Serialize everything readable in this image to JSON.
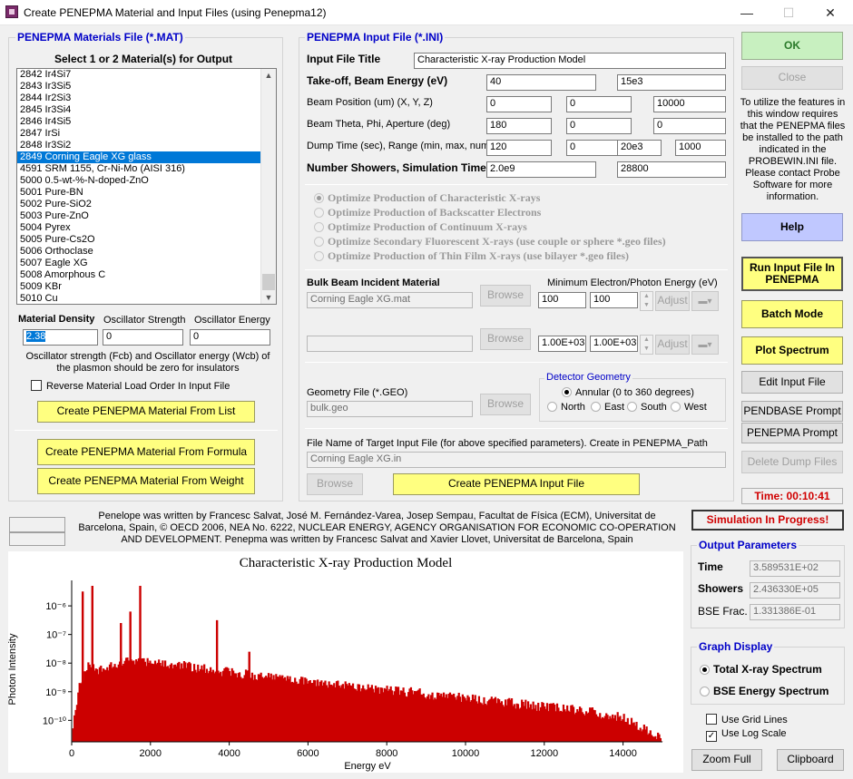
{
  "window": {
    "title": "Create PENEPMA Material and Input Files (using Penepma12)",
    "min": "—",
    "max": "☐",
    "close": "✕"
  },
  "mat": {
    "group_label": "PENEPMA Materials File (*.MAT)",
    "select_heading": "Select 1 or 2 Material(s) for Output",
    "list": [
      "2842 Ir4Si7",
      "2843 Ir3Si5",
      "2844 Ir2Si3",
      "2845 Ir3Si4",
      "2846 Ir4Si5",
      "2847 IrSi",
      "2848 Ir3Si2",
      "2849 Corning Eagle XG glass",
      "4591 SRM 1155, Cr-Ni-Mo (AISI 316)",
      "5000 0.5-wt-%-N-doped-ZnO",
      "5001 Pure-BN",
      "5002 Pure-SiO2",
      "5003 Pure-ZnO",
      "5004 Pyrex",
      "5005 Pure-Cs2O",
      "5006 Orthoclase",
      "5007 Eagle XG",
      "5008 Amorphous C",
      "5009 KBr",
      "5010 Cu"
    ],
    "selected_index": 7,
    "density_label": "Material Density",
    "osc_strength_label": "Oscillator Strength",
    "osc_energy_label": "Oscillator Energy",
    "density": "2.38",
    "osc_strength": "0",
    "osc_energy": "0",
    "note": "Oscillator strength (Fcb) and Oscillator energy (Wcb) of the plasmon should be zero for insulators",
    "reverse_label": "Reverse Material Load Order In Input File",
    "from_list": "Create PENEPMA Material From List",
    "from_formula": "Create PENEPMA Material From Formula",
    "from_weight": "Create PENEPMA Material From Weight"
  },
  "ini": {
    "group_label": "PENEPMA Input File (*.INI)",
    "title_label": "Input File Title",
    "title": "Characteristic X-ray Production Model",
    "takeoff_label": "Take-off, Beam Energy (eV)",
    "takeoff": "40",
    "energy": "15e3",
    "pos_label": "Beam Position (um) (X, Y, Z)",
    "pos": [
      "0",
      "0",
      "10000"
    ],
    "theta_label": "Beam Theta, Phi, Aperture (deg)",
    "theta": [
      "180",
      "0",
      "0"
    ],
    "dump_label": "Dump Time (sec), Range (min, max, num)",
    "dump": [
      "120",
      "0",
      "20e3",
      "1000"
    ],
    "showers_label": "Number Showers, Simulation Time",
    "showers": "2.0e9",
    "simtime": "28800",
    "opts": [
      "Optimize Production of Characteristic X-rays",
      "Optimize Production of Backscatter Electrons",
      "Optimize Production of Continuum X-rays",
      "Optimize Secondary Fluorescent X-rays (use couple or sphere *.geo files)",
      "Optimize Production of Thin Film X-rays (use bilayer *.geo files)"
    ],
    "bulk_label": "Bulk Beam Incident Material",
    "min_energy_label": "Minimum Electron/Photon Energy (eV)",
    "bulk_mat": "Corning Eagle XG.mat",
    "browse": "Browse",
    "e1": "100",
    "e2": "100",
    "adjust": "Adjust",
    "mat2": "",
    "e3": "1.00E+03",
    "e4": "1.00E+03",
    "geo_label": "Geometry File (*.GEO)",
    "geo": "bulk.geo",
    "det_label": "Detector Geometry",
    "annular": "Annular (0 to 360 degrees)",
    "north": "North",
    "east": "East",
    "south": "South",
    "west": "West",
    "target_label": "File Name of Target Input File (for above specified parameters). Create in PENEPMA_Path",
    "target": "Corning Eagle XG.in",
    "create_ini": "Create PENEPMA Input File"
  },
  "right": {
    "ok": "OK",
    "close": "Close",
    "info": "To utilize the features in this window requires that the PENEPMA files be installed to the path indicated in the PROBEWIN.INI file. Please contact Probe Software for more information.",
    "help": "Help",
    "run": "Run Input File In PENEPMA",
    "batch": "Batch Mode",
    "plot": "Plot Spectrum",
    "edit": "Edit Input File",
    "pendbase": "PENDBASE Prompt",
    "penepma_prompt": "PENEPMA Prompt",
    "delete_dump": "Delete Dump Files",
    "time": "Time: 00:10:41"
  },
  "credits": "Penelope was written by Francesc Salvat, José M. Fernández-Varea, Josep Sempau, Facultat de Física (ECM), Universitat de Barcelona, Spain, © OECD 2006, NEA No. 6222, NUCLEAR ENERGY, AGENCY ORGANISATION FOR ECONOMIC CO-OPERATION AND DEVELOPMENT. Penepma was written by Francesc Salvat and Xavier Llovet, Universitat de Barcelona, Spain",
  "status": "Simulation In Progress!",
  "output": {
    "label": "Output Parameters",
    "time_label": "Time",
    "time": "3.589531E+02",
    "showers_label": "Showers",
    "showers": "2.436330E+05",
    "bse_label": "BSE Frac.",
    "bse": "1.331386E-01"
  },
  "graph": {
    "label": "Graph Display",
    "total": "Total X-ray Spectrum",
    "bse": "BSE Energy Spectrum",
    "grid": "Use Grid Lines",
    "log": "Use Log Scale",
    "zoom": "Zoom Full",
    "clip": "Clipboard"
  },
  "colors": {
    "accent": "#0000c8",
    "series": "#cc0000",
    "status_red": "#d00000"
  },
  "chart_data": {
    "type": "bar",
    "title": "Characteristic X-ray Production Model",
    "xlabel": "Energy eV",
    "ylabel": "Photon Intensity",
    "xlim": [
      0,
      15000
    ],
    "ylim_log10": [
      -10.75,
      -5.3
    ],
    "yscale": "log",
    "x_ticks": [
      0,
      2000,
      4000,
      6000,
      8000,
      10000,
      12000,
      14000
    ],
    "y_tick_labels": [
      "10⁻⁶",
      "10⁻⁷",
      "10⁻⁸",
      "10⁻⁹",
      "10⁻¹⁰"
    ],
    "y_tick_exponents": [
      -6,
      -7,
      -8,
      -9,
      -10
    ],
    "continuum": {
      "x": [
        0,
        200,
        400,
        700,
        1000,
        1300,
        2000,
        3000,
        4000,
        5000,
        6000,
        7000,
        8000,
        9000,
        10000,
        11000,
        12000,
        13000,
        14000,
        15000
      ],
      "log10_y": [
        -10.7,
        -8.8,
        -8.2,
        -8.3,
        -8.2,
        -8.0,
        -8.05,
        -8.2,
        -8.4,
        -8.55,
        -8.7,
        -8.85,
        -9.0,
        -9.15,
        -9.3,
        -9.45,
        -9.6,
        -9.75,
        -9.95,
        -10.7
      ]
    },
    "peaks": {
      "x": [
        280,
        525,
        1250,
        1490,
        1740,
        3690,
        4510
      ],
      "log10_y": [
        -5.5,
        -5.3,
        -6.6,
        -6.2,
        -5.3,
        -6.5,
        -7.6
      ]
    }
  }
}
